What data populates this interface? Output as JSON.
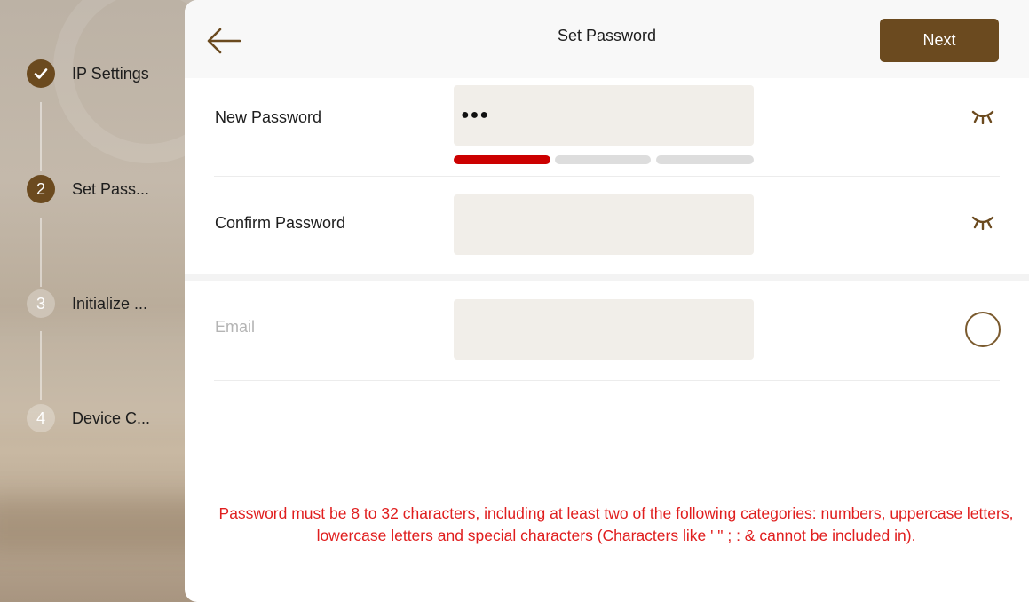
{
  "sidebar": {
    "steps": [
      {
        "number": "",
        "label": "IP Settings",
        "state": "done"
      },
      {
        "number": "2",
        "label": "Set Pass...",
        "state": "active"
      },
      {
        "number": "3",
        "label": "Initialize ...",
        "state": "pending"
      },
      {
        "number": "4",
        "label": "Device C...",
        "state": "pending"
      }
    ]
  },
  "header": {
    "title": "Set Password",
    "next_label": "Next"
  },
  "form": {
    "new_password": {
      "label": "New Password",
      "value": "●●●",
      "strength": "weak"
    },
    "confirm_password": {
      "label": "Confirm Password",
      "value": ""
    },
    "email": {
      "label": "Email",
      "value": ""
    }
  },
  "hint": "Password must be 8 to 32 characters, including at least two of the following categories: numbers, uppercase letters, lowercase letters and special characters (Characters like ' \" ; : & cannot be included in).",
  "colors": {
    "accent": "#6b4a1f",
    "error": "#e01e1e",
    "field": "#f1eee9",
    "strength_weak": "#cc0000",
    "strength_empty": "#dddddd"
  },
  "icons": {
    "back": "arrow-left-icon",
    "done": "checkmark-icon",
    "password_visibility": "eye-closed-icon",
    "email_toggle": "radio-circle-icon"
  }
}
